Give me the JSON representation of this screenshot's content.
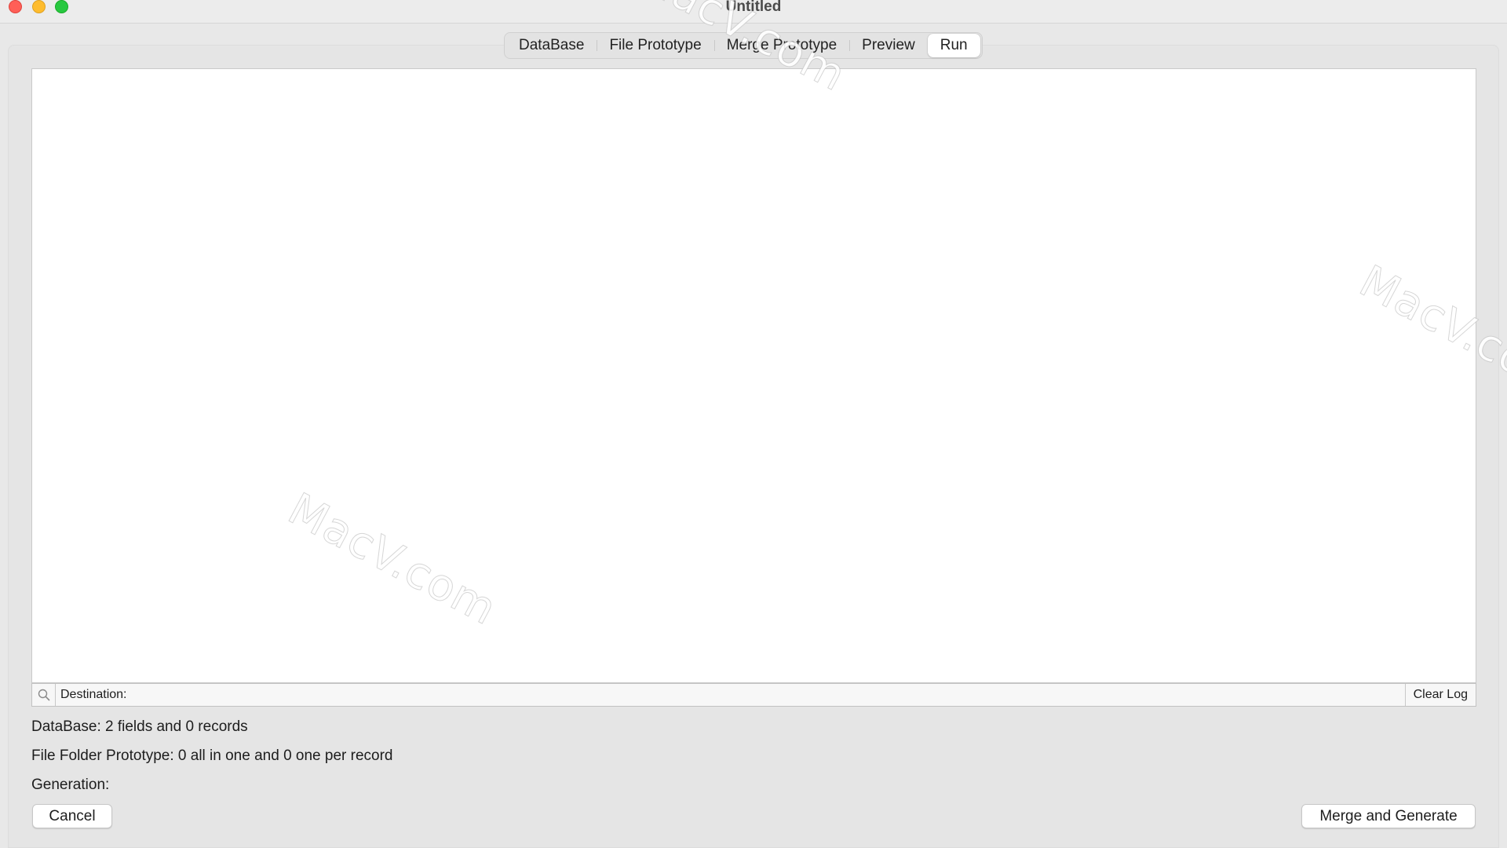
{
  "window": {
    "title": "Untitled"
  },
  "tabs": [
    {
      "label": "DataBase",
      "active": false
    },
    {
      "label": "File Prototype",
      "active": false
    },
    {
      "label": "Merge Prototype",
      "active": false
    },
    {
      "label": "Preview",
      "active": false
    },
    {
      "label": "Run",
      "active": true
    }
  ],
  "log": {
    "content": ""
  },
  "destination": {
    "label": "Destination:",
    "clear_label": "Clear Log",
    "icon": "search-icon"
  },
  "status": {
    "database": "DataBase:  2 fields and 0 records",
    "file_folder": "File Folder Prototype: 0 all in one and 0 one per record",
    "generation": "Generation:"
  },
  "buttons": {
    "cancel": "Cancel",
    "merge": "Merge and Generate"
  },
  "watermark": "MacV.com",
  "colors": {
    "close": "#ff5f57",
    "minimize": "#febc2e",
    "maximize": "#28c840"
  }
}
